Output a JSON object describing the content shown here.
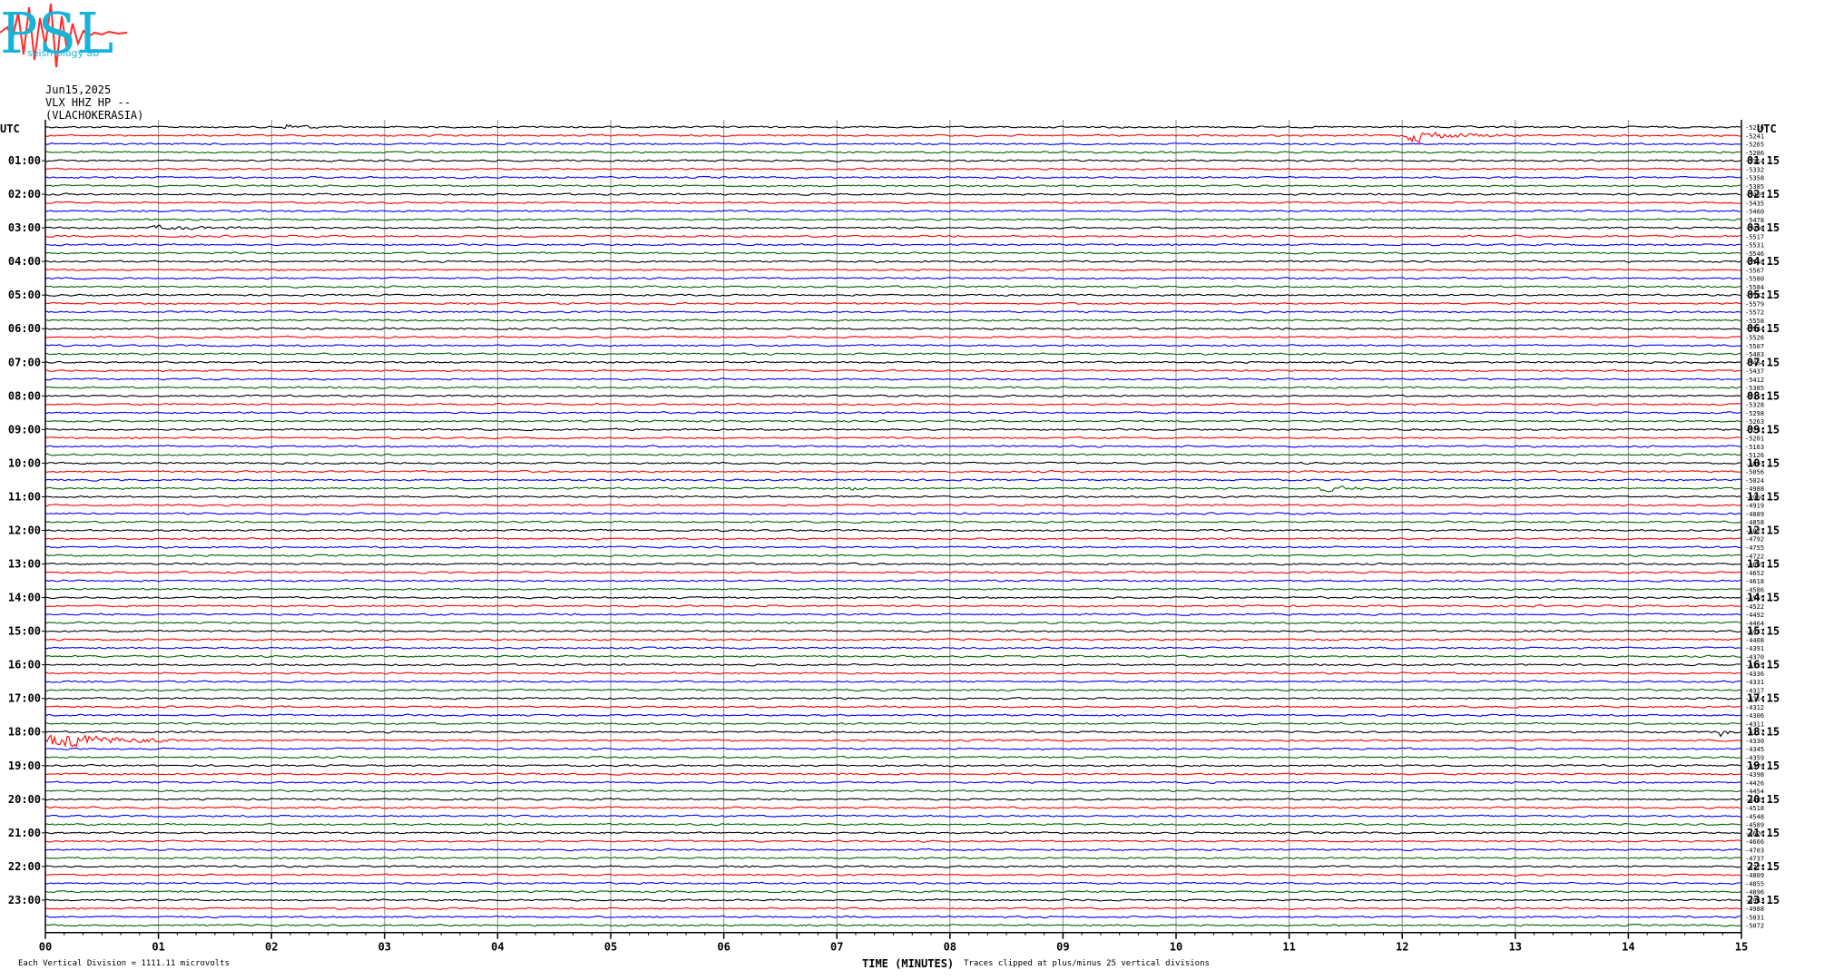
{
  "logo": {
    "letters": "PSL",
    "subtitle": "seismology ab"
  },
  "header": {
    "date": "Jun15,2025",
    "channel": "VLX HHZ HP --",
    "station": "(VLACHOKERASIA)"
  },
  "left_axis_title": "UTC",
  "right_axis_title": "UTC",
  "footer": {
    "division_note": "Each Vertical Division = 1111.11 microvolts",
    "xlabel": "TIME (MINUTES)",
    "clip_note": "Traces clipped at plus/minus 25 vertical divisions"
  },
  "chart_data": {
    "type": "line",
    "xlabel": "TIME (MINUTES)",
    "xlim": [
      0,
      15
    ],
    "x_ticks": [
      "00",
      "01",
      "02",
      "03",
      "04",
      "05",
      "06",
      "07",
      "08",
      "09",
      "10",
      "11",
      "12",
      "13",
      "14",
      "15"
    ],
    "trace_colors": [
      "#000000",
      "#ff0000",
      "#0000ff",
      "#006400"
    ],
    "traces_per_hour": 4,
    "trace_count": 96,
    "left_hour_labels": [
      "01:00",
      "02:00",
      "03:00",
      "04:00",
      "05:00",
      "06:00",
      "07:00",
      "08:00",
      "09:00",
      "10:00",
      "11:00",
      "12:00",
      "13:00",
      "14:00",
      "15:00",
      "16:00",
      "17:00",
      "18:00",
      "19:00",
      "20:00",
      "21:00",
      "22:00",
      "23:00"
    ],
    "right_hour_labels": [
      "01:15",
      "02:15",
      "03:15",
      "04:15",
      "05:15",
      "06:15",
      "07:15",
      "08:15",
      "09:15",
      "10:15",
      "11:15",
      "12:15",
      "13:15",
      "14:15",
      "15:15",
      "16:15",
      "17:15",
      "18:15",
      "19:15",
      "20:15",
      "21:15",
      "22:15",
      "23:15"
    ],
    "trace_offsets": [
      "-5216",
      "-5241",
      "-5265",
      "-5286",
      "-5314",
      "-5332",
      "-5358",
      "-5385",
      "-5409",
      "-5435",
      "-5460",
      "-5478",
      "-5498",
      "-5517",
      "-5531",
      "-5546",
      "-5558",
      "-5567",
      "-5580",
      "-5584",
      "-5582",
      "-5579",
      "-5572",
      "-5558",
      "-5544",
      "-5526",
      "-5507",
      "-5483",
      "-5464",
      "-5437",
      "-5412",
      "-5385",
      "-5355",
      "-5328",
      "-5298",
      "-5263",
      "-5231",
      "-5201",
      "-5163",
      "-5126",
      "-5093",
      "-5056",
      "-5024",
      "-4988",
      "-4950",
      "-4919",
      "-4889",
      "-4858",
      "-4823",
      "-4792",
      "-4755",
      "-4722",
      "-4689",
      "-4652",
      "-4618",
      "-4586",
      "-4555",
      "-4522",
      "-4492",
      "-4464",
      "-4437",
      "-4408",
      "-4391",
      "-4370",
      "-4355",
      "-4336",
      "-4331",
      "-4317",
      "-4314",
      "-4312",
      "-4306",
      "-4311",
      "-4317",
      "-4330",
      "-4345",
      "-4359",
      "-4379",
      "-4398",
      "-4426",
      "-4454",
      "-4485",
      "-4518",
      "-4548",
      "-4589",
      "-4626",
      "-4666",
      "-4703",
      "-4737",
      "-4773",
      "-4809",
      "-4855",
      "-4896",
      "-4943",
      "-4988",
      "-5031",
      "-5072"
    ],
    "events": [
      {
        "trace": 0,
        "start_min": 2.1,
        "end_min": 2.5,
        "amplitude": 1.6
      },
      {
        "trace": 1,
        "start_min": 12.0,
        "end_min": 13.0,
        "amplitude": 2.6
      },
      {
        "trace": 12,
        "start_min": 0.9,
        "end_min": 2.1,
        "amplitude": 0.7
      },
      {
        "trace": 43,
        "start_min": 11.2,
        "end_min": 12.3,
        "amplitude": 0.9
      },
      {
        "trace": 43,
        "start_min": 7.1,
        "end_min": 7.4,
        "amplitude": 0.8
      },
      {
        "trace": 73,
        "start_min": 0.0,
        "end_min": 1.2,
        "amplitude": 4.2
      },
      {
        "trace": 72,
        "start_min": 14.8,
        "end_min": 15.0,
        "amplitude": 2.2
      }
    ]
  }
}
